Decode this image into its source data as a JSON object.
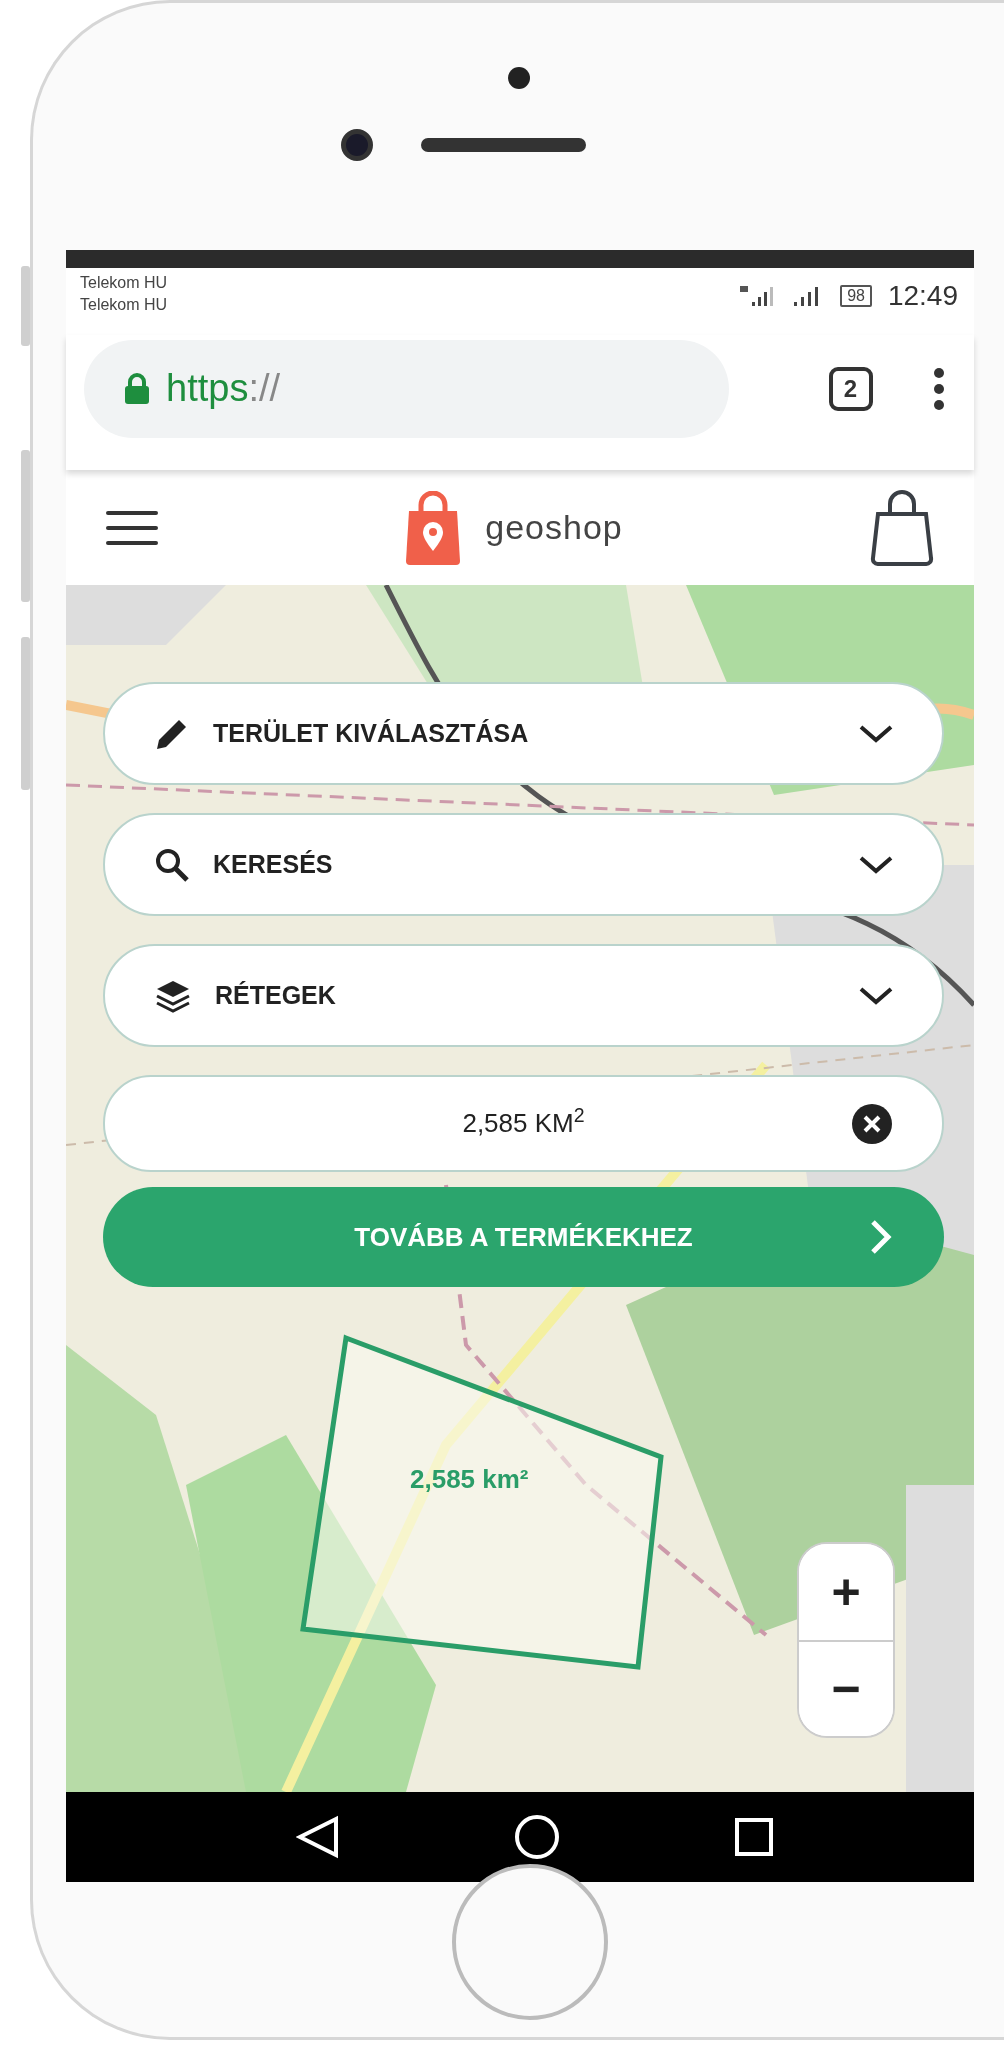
{
  "status_bar": {
    "carriers": [
      "Telekom HU",
      "Telekom HU"
    ],
    "battery": "98",
    "time": "12:49"
  },
  "browser": {
    "url_scheme": "https",
    "url_rest": "://",
    "tab_count": "2"
  },
  "app_header": {
    "brand": "geoshop"
  },
  "panels": [
    {
      "label": "TERÜLET KIVÁLASZTÁSA",
      "expanded": false
    },
    {
      "label": "KERESÉS",
      "expanded": false
    },
    {
      "label": "RÉTEGEK",
      "expanded": false
    }
  ],
  "area_field": {
    "value": "2,585 KM$^{2}$"
  },
  "continue_button": {
    "label": "TOVÁBB A TERMÉKEKHEZ"
  },
  "map": {
    "polygon_label": "2,585 km²",
    "zoom_in": "+",
    "zoom_out": "−"
  }
}
